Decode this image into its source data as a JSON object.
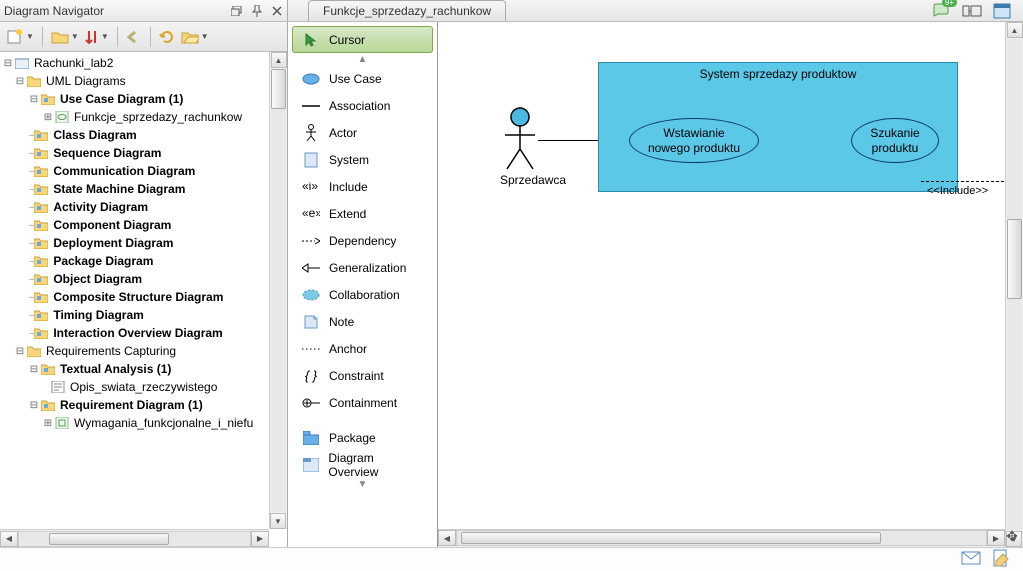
{
  "navigator": {
    "title": "Diagram Navigator"
  },
  "tab": {
    "label": "Funkcje_sprzedazy_rachunkow"
  },
  "tree": {
    "root": "Rachunki_lab2",
    "uml_group": "UML Diagrams",
    "items": [
      "Use Case Diagram (1)",
      "Funkcje_sprzedazy_rachunkow",
      "Class Diagram",
      "Sequence Diagram",
      "Communication Diagram",
      "State Machine Diagram",
      "Activity Diagram",
      "Component Diagram",
      "Deployment Diagram",
      "Package Diagram",
      "Object Diagram",
      "Composite Structure Diagram",
      "Timing Diagram",
      "Interaction Overview Diagram"
    ],
    "req_group": "Requirements Capturing",
    "req_items": [
      "Textual Analysis (1)",
      "Opis_swiata_rzeczywistego",
      "Requirement Diagram (1)",
      "Wymagania_funkcjonalne_i_niefu"
    ]
  },
  "palette": {
    "items": [
      "Cursor",
      "Use Case",
      "Association",
      "Actor",
      "System",
      "Include",
      "Extend",
      "Dependency",
      "Generalization",
      "Collaboration",
      "Note",
      "Anchor",
      "Constraint",
      "Containment",
      "Package",
      "Diagram Overview"
    ]
  },
  "diagram": {
    "system_title": "System sprzedazy produktow",
    "actor": "Sprzedawca",
    "uc1_l1": "Wstawianie",
    "uc1_l2": "nowego produktu",
    "uc2_l1": "Szukanie",
    "uc2_l2": "produktu",
    "include": "<<Include>>"
  },
  "badge": "9+"
}
